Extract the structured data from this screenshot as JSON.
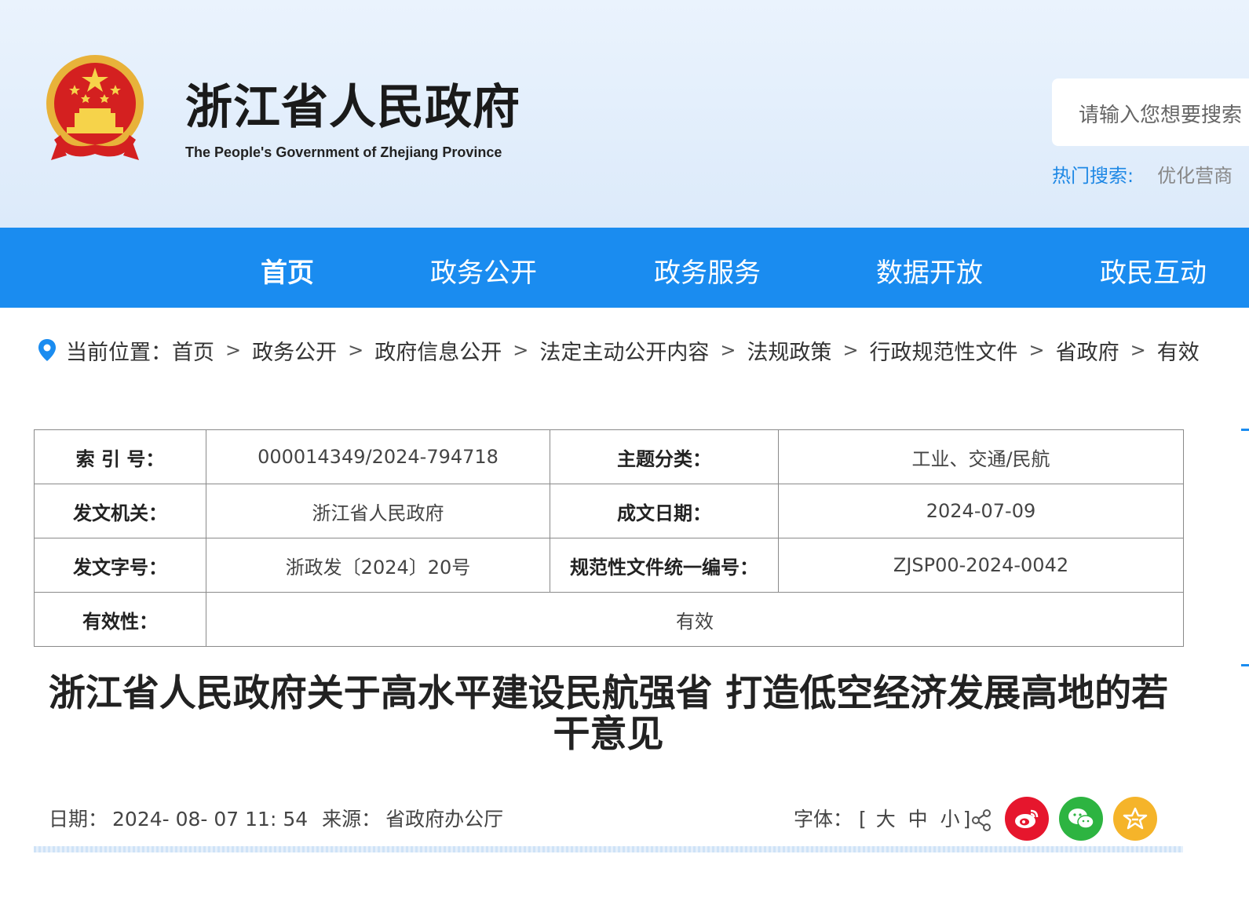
{
  "header": {
    "title": "浙江省人民政府",
    "subtitle": "The People's Government of Zhejiang Province",
    "search_placeholder": "请输入您想要搜索",
    "hot_search_label": "热门搜索:",
    "hot_search_item": "优化营商"
  },
  "nav": [
    {
      "label": "首页",
      "active": true
    },
    {
      "label": "政务公开",
      "active": false
    },
    {
      "label": "政务服务",
      "active": false
    },
    {
      "label": "数据开放",
      "active": false
    },
    {
      "label": "政民互动",
      "active": false
    }
  ],
  "breadcrumb": {
    "prefix": "当前位置：",
    "items": [
      "首页",
      "政务公开",
      "政府信息公开",
      "法定主动公开内容",
      "法规政策",
      "行政规范性文件",
      "省政府",
      "有效"
    ],
    "separator": ">"
  },
  "info_table": {
    "index_no_label": "索 引 号：",
    "index_no": "000014349/2024-794718",
    "topic_label": "主题分类：",
    "topic": "工业、交通/民航",
    "issuer_label": "发文机关：",
    "issuer": "浙江省人民政府",
    "date_label": "成文日期：",
    "date": "2024-07-09",
    "doc_no_label": "发文字号：",
    "doc_no": "浙政发〔2024〕20号",
    "unified_no_label": "规范性文件统一编号：",
    "unified_no": "ZJSP00-2024-0042",
    "validity_label": "有效性：",
    "validity": "有效"
  },
  "article": {
    "title": "浙江省人民政府关于高水平建设民航强省 打造低空经济发展高地的若干意见"
  },
  "meta": {
    "date_label": "日期：",
    "date": "2024- 08- 07 11: 54",
    "source_label": "来源：",
    "source": "省政府办公厅",
    "font_label": "字体：",
    "font_open": "[",
    "font_large": "大",
    "font_medium": "中",
    "font_small": "小",
    "font_close": "]"
  },
  "colors": {
    "nav_bg": "#1a8cf0",
    "weibo": "#e6162d",
    "wechat": "#2db441",
    "favorite": "#f5b42a"
  },
  "icons": [
    "location-pin-icon",
    "share-icon",
    "weibo-icon",
    "wechat-icon",
    "favorite-star-icon",
    "national-emblem"
  ]
}
